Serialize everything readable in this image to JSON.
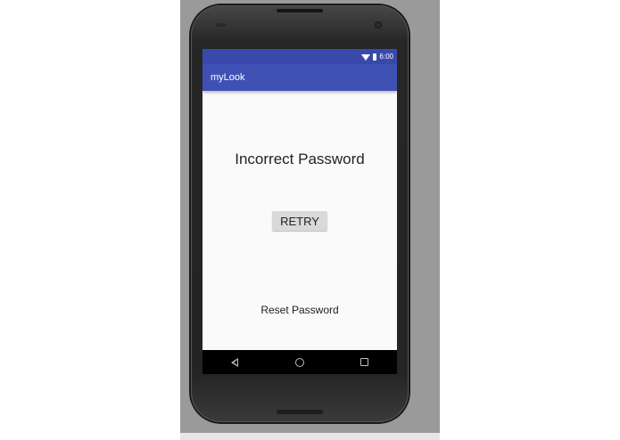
{
  "status_bar": {
    "time": "6:00",
    "wifi_icon": "wifi-icon",
    "battery_icon": "battery-icon"
  },
  "app_bar": {
    "title": "myLook",
    "color": "#3f51b5"
  },
  "content": {
    "message": "Incorrect Password",
    "retry_label": "RETRY",
    "reset_link": "Reset Password"
  },
  "nav_bar": {
    "buttons": [
      "back-icon",
      "home-icon",
      "recents-icon"
    ]
  }
}
